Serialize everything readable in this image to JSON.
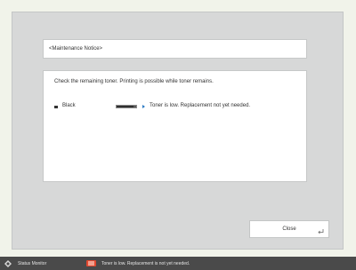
{
  "notice": {
    "title": "<Maintenance Notice>"
  },
  "content": {
    "instructions": "Check the remaining toner. Printing is possible while toner remains.",
    "toner": {
      "color_label": "Black",
      "level_fraction": 0.85,
      "status": "Toner is low. Replacement not yet needed."
    }
  },
  "buttons": {
    "close_label": "Close"
  },
  "statusbar": {
    "monitor_label": "Status Monitor",
    "message": "Toner is low. Replacement is not yet needed."
  },
  "icons": {
    "bullet": "bullet-icon",
    "arrow": "arrow-right-icon",
    "enter": "enter-icon",
    "monitor": "status-monitor-icon",
    "alert": "toner-alert-icon"
  },
  "colors": {
    "alert": "#e1472f",
    "arrow": "#2e7bc4",
    "statusbar_bg": "#4a4a4a"
  }
}
